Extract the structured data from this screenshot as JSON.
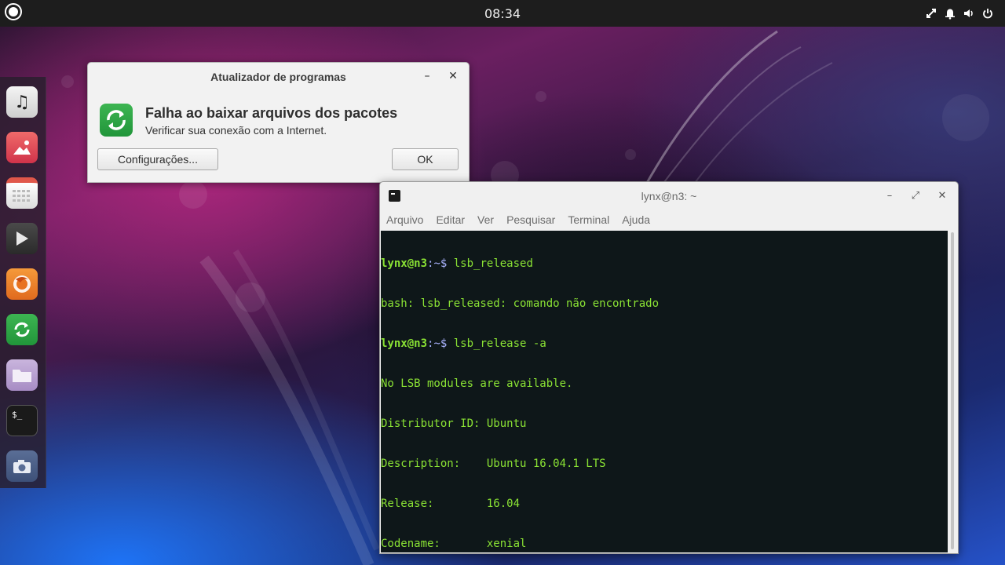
{
  "top_panel": {
    "clock": "08:34",
    "tray_icons": [
      "network-icon",
      "notification-bell-icon",
      "volume-icon",
      "power-icon"
    ]
  },
  "launcher": {
    "items": [
      {
        "name": "music-app",
        "icon": "music-note-icon"
      },
      {
        "name": "image-viewer",
        "icon": "image-icon"
      },
      {
        "name": "calendar",
        "icon": "calendar-icon"
      },
      {
        "name": "video-player",
        "icon": "play-icon"
      },
      {
        "name": "firefox",
        "icon": "firefox-icon"
      },
      {
        "name": "software-updater",
        "icon": "software-updater-icon"
      },
      {
        "name": "files",
        "icon": "folder-icon"
      },
      {
        "name": "terminal",
        "icon": "terminal-icon"
      },
      {
        "name": "screenshot",
        "icon": "camera-icon"
      }
    ]
  },
  "dialog": {
    "title": "Atualizador de programas",
    "heading": "Falha ao baixar arquivos dos pacotes",
    "message": "Verificar sua conexão com a Internet.",
    "settings_button": "Configurações...",
    "ok_button": "OK",
    "minimize_glyph": "–",
    "close_glyph": "✕"
  },
  "terminal": {
    "title": "lynx@n3: ~",
    "menu": [
      "Arquivo",
      "Editar",
      "Ver",
      "Pesquisar",
      "Terminal",
      "Ajuda"
    ],
    "prompt": "lynx@n3",
    "path": ":~$",
    "lines": {
      "cmd1": " lsb_released",
      "out1": "bash: lsb_released: comando não encontrado",
      "cmd2": " lsb_release -a",
      "out2": "No LSB modules are available.",
      "out3": "Distributor ID:\tUbuntu",
      "out4": "Description:\tUbuntu 16.04.1 LTS",
      "out5": "Release:\t16.04",
      "out6": "Codename:\txenial",
      "cmd3": " _"
    },
    "minimize_glyph": "–",
    "maximize_glyph": "⤢",
    "close_glyph": "✕"
  },
  "colors": {
    "terminal_text": "#8ae234",
    "terminal_bg": "#061012",
    "panel_bg": "#1d1d1d",
    "updater_green": "#2fa84a"
  }
}
